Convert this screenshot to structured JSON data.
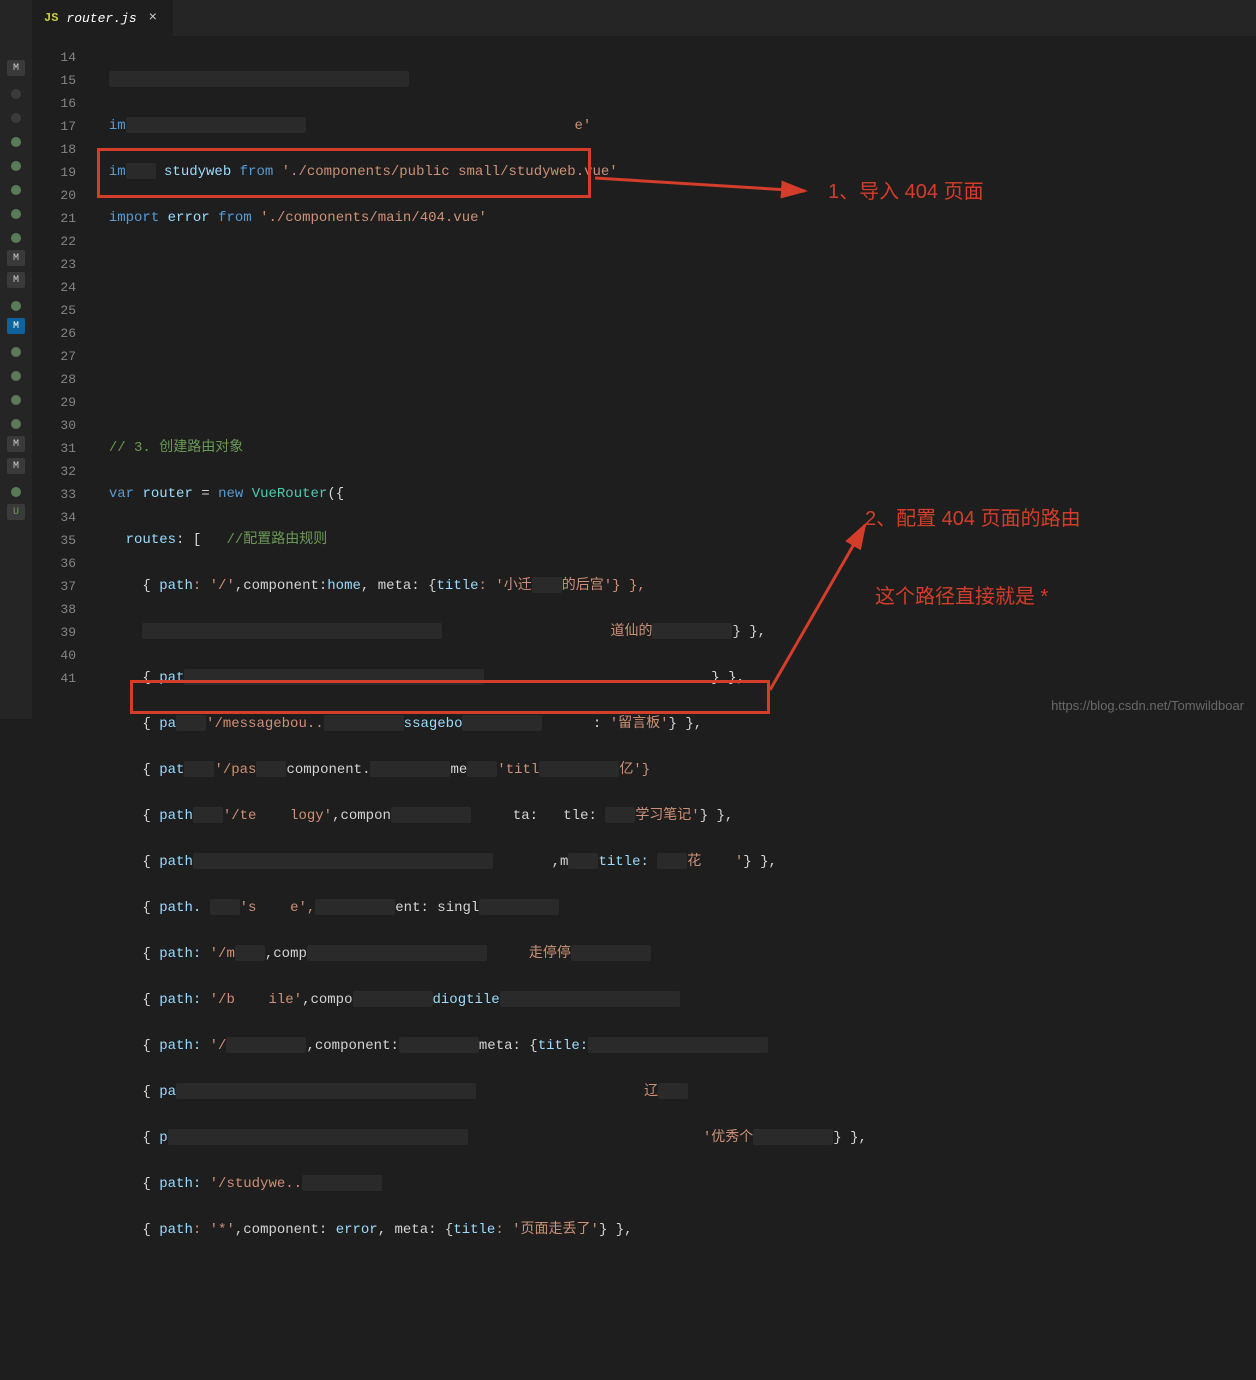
{
  "tab": {
    "icon": "JS",
    "title": "router.js",
    "close": "×"
  },
  "activity": {
    "badges": [
      "M",
      "",
      "",
      "",
      "",
      "",
      "",
      "",
      "M",
      "M",
      "",
      "M",
      "",
      "",
      "",
      "",
      "M",
      "M",
      "",
      "U"
    ],
    "dot_indices": [
      1,
      2,
      3,
      4,
      5,
      6,
      7,
      10,
      12,
      13,
      14,
      15,
      18
    ]
  },
  "line_numbers": [
    "14",
    "15",
    "16",
    "17",
    "18",
    "19",
    "20",
    "21",
    "22",
    "23",
    "24",
    "25",
    "26",
    "27",
    "28",
    "29",
    "30",
    "31",
    "32",
    "33",
    "34",
    "35",
    "36",
    "37",
    "38",
    "39",
    "40",
    "41"
  ],
  "code": {
    "l15": {
      "kw": "im"
    },
    "l16": {
      "kw": "im",
      "mid": " studyweb ",
      "from": "from",
      "str": "'./components/public small/studyweb.vue'"
    },
    "l17": {
      "kw": "import",
      "var": "error",
      "from": "from",
      "str": "'./components/main/404.vue'"
    },
    "l22": {
      "comment": "// 3. 创建路由对象"
    },
    "l23": {
      "kw1": "var",
      "var": "router",
      "eq": " = ",
      "kw2": "new",
      "cls": "VueRouter",
      "open": "({"
    },
    "l24": {
      "prop": "routes",
      "open": ": [   ",
      "comment": "//配置路由规则"
    },
    "l25": {
      "open": "{ ",
      "path_key": "path",
      "path_val": ": '/'",
      "comp": ",component:",
      "comp_val": "home",
      "meta": ", meta:",
      "meta_open": " {",
      "title_key": "title",
      "title_val": ": '小迁",
      "tail": "的后宫'} },"
    },
    "l26": {
      "tail": "} },"
    },
    "l27": {
      "open": "{ ",
      "path_key": "pat",
      "tail": "} },"
    },
    "l28": {
      "open": "{ ",
      "path_key": "pa",
      "str_frag": "'/messagebou..",
      "mid": "ssagebo",
      "title_key": "      : ",
      "title_val": "'留言板'",
      "tail": "} },"
    },
    "l29": {
      "open": "{ ",
      "path_key": "pat",
      "str_frag": "'/pas",
      "comp": "component.",
      "meta_frag": "'titl",
      "tail2": "亿'}"
    },
    "l30": {
      "open": "{ ",
      "path_key": "path",
      "str_frag": "'/te    logy'",
      "comp": ",compon",
      "tle": "tle:",
      "tail_str": "学习笔记'",
      "tail": "} },"
    },
    "l31": {
      "open": "{ ",
      "path_key": "path",
      "title_key": "title: ",
      "tail_str": "花    '",
      "tail": "} },"
    },
    "l32": {
      "open": "{ ",
      "path_key": "path.",
      "frag": "'s    e',",
      "ent": "ent: singl"
    },
    "l33": {
      "open": "{ ",
      "path_key": "path:",
      "str_frag": " '/m",
      "comp": ",comp",
      "tail_frag": "走停停"
    },
    "l34": {
      "open": "{ ",
      "path_key": "path:",
      "str_frag": " '/b    ile'",
      "comp": ",compo",
      "mid": "diogtile"
    },
    "l35": {
      "open": "{ ",
      "path_key": "path:",
      "str_frag": " '/",
      "comp": ",component:",
      "meta": "meta:",
      "meta_open": " {",
      "title_key": "title:"
    },
    "l36": {
      "open": "{ ",
      "path_key": "pa",
      "tail_frag": "辽"
    },
    "l37": {
      "open": "{ ",
      "path_key": "p",
      "tail_str": "'优秀个",
      "tail": "} },"
    },
    "l38": {
      "open": "{ ",
      "path_key": "path:",
      "str_frag": " '/studywe.."
    },
    "l39": {
      "open": "{ ",
      "path_key": "path",
      "path_val": ": '*'",
      "comp": ",component: ",
      "comp_val": "error",
      "meta": ", meta:",
      "meta_open": " {",
      "title_key": "title",
      "title_val": ": '页面走丢了'",
      "tail": "} },"
    }
  },
  "annotations": {
    "a1": "1、导入 404 页面",
    "a2": "2、配置 404 页面的路由",
    "a3": "这个路径直接就是  *"
  },
  "watermark": "https://blog.csdn.net/Tomwildboar"
}
